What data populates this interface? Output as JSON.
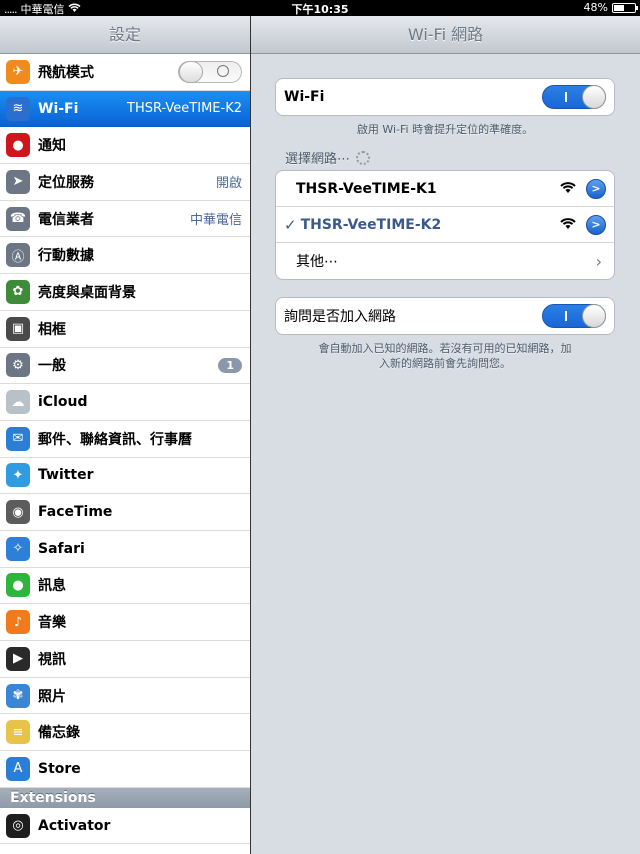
{
  "statusbar": {
    "carrier": "中華電信",
    "time": "下午10:35",
    "battery": "48%",
    "battery_level": 0.48
  },
  "master": {
    "title": "設定",
    "items": [
      {
        "label": "飛航模式",
        "icon": "airplane-icon",
        "color": "#f08c1e",
        "value": "",
        "toggle": "off"
      },
      {
        "label": "Wi-Fi",
        "icon": "wifi-icon",
        "color": "#2a6fd0",
        "value": "THSR-VeeTIME-K2",
        "selected": true
      },
      {
        "label": "通知",
        "icon": "notifications-icon",
        "color": "#d0161d",
        "value": ""
      },
      {
        "label": "定位服務",
        "icon": "location-icon",
        "color": "#6c7684",
        "value": "開啟"
      },
      {
        "label": "電信業者",
        "icon": "phone-icon",
        "color": "#6c7684",
        "value": "中華電信"
      },
      {
        "label": "行動數據",
        "icon": "cellular-icon",
        "color": "#6c7684",
        "value": ""
      },
      {
        "label": "亮度與桌面背景",
        "icon": "brightness-icon",
        "color": "#3e8c3a",
        "value": ""
      },
      {
        "label": "相框",
        "icon": "picture-frame-icon",
        "color": "#4a4a4a",
        "value": ""
      },
      {
        "label": "一般",
        "icon": "gear-icon",
        "color": "#6c7684",
        "value": "",
        "badge": "1"
      },
      {
        "label": "iCloud",
        "icon": "cloud-icon",
        "color": "#b8c0c8",
        "value": ""
      },
      {
        "label": "郵件、聯絡資訊、行事曆",
        "icon": "mail-icon",
        "color": "#2a7ed6",
        "value": ""
      },
      {
        "label": "Twitter",
        "icon": "twitter-icon",
        "color": "#2f9be0",
        "value": ""
      },
      {
        "label": "FaceTime",
        "icon": "facetime-icon",
        "color": "#5c5c5c",
        "value": ""
      },
      {
        "label": "Safari",
        "icon": "compass-icon",
        "color": "#2e7fd8",
        "value": ""
      },
      {
        "label": "訊息",
        "icon": "messages-icon",
        "color": "#2fb53b",
        "value": ""
      },
      {
        "label": "音樂",
        "icon": "music-icon",
        "color": "#f07a1c",
        "value": ""
      },
      {
        "label": "視訊",
        "icon": "video-icon",
        "color": "#2a2a2a",
        "value": ""
      },
      {
        "label": "照片",
        "icon": "photos-icon",
        "color": "#3b85d6",
        "value": ""
      },
      {
        "label": "備忘錄",
        "icon": "notes-icon",
        "color": "#e8c34a",
        "value": ""
      },
      {
        "label": "Store",
        "icon": "app-store-icon",
        "color": "#2a7ed6",
        "value": ""
      }
    ],
    "extensions_header": "Extensions",
    "extensions": [
      {
        "label": "Activator",
        "icon": "activator-icon",
        "color": "#1e1e1e",
        "value": ""
      }
    ]
  },
  "detail": {
    "title": "Wi-Fi 網路",
    "wifi_label": "Wi-Fi",
    "wifi_toggle": "on",
    "wifi_footer": "啟用 Wi-Fi 時會提升定位的準確度。",
    "choose_network": "選擇網路⋯",
    "networks": [
      {
        "name": "THSR-VeeTIME-K1",
        "checked": false
      },
      {
        "name": "THSR-VeeTIME-K2",
        "checked": true
      }
    ],
    "other_label": "其他⋯",
    "ask_label": "詢問是否加入網路",
    "ask_toggle": "on",
    "ask_footer_line1": "會自動加入已知的網路。若沒有可用的已知網路，加",
    "ask_footer_line2": "入新的網路前會先詢問您。",
    "accent": "#1a66d6",
    "checked_color": "#3a5a8c"
  }
}
